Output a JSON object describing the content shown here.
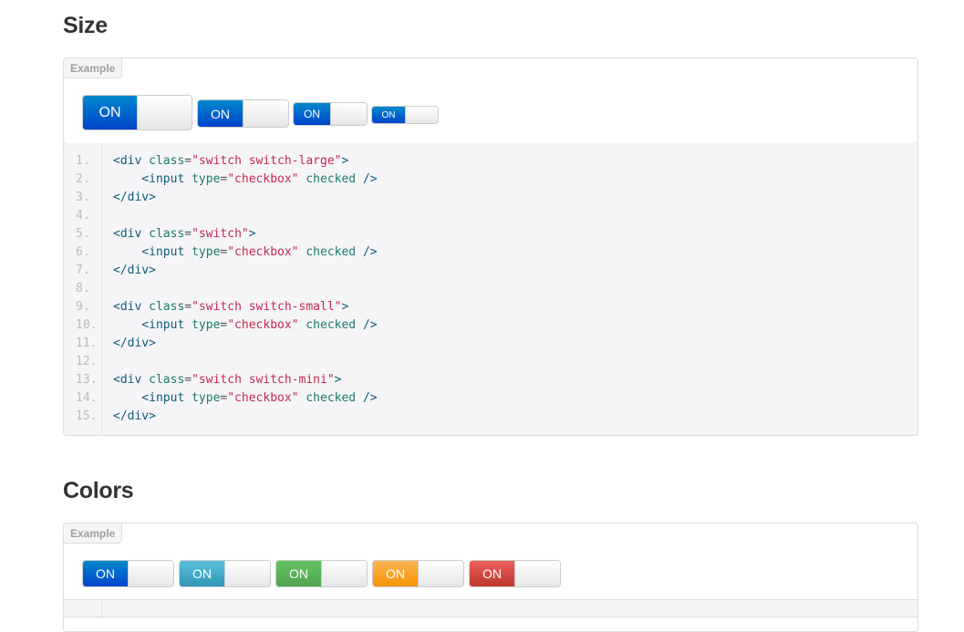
{
  "size_section": {
    "title": "Size",
    "example_label": "Example",
    "switch_label": "ON",
    "code_lines": [
      {
        "num": "1.",
        "parts": [
          [
            "tag",
            "<div "
          ],
          [
            "attr",
            "class"
          ],
          [
            "pun",
            "="
          ],
          [
            "str",
            "\"switch switch-large\""
          ],
          [
            "tag",
            ">"
          ]
        ]
      },
      {
        "num": "2.",
        "parts": [
          [
            "tag",
            "    <input "
          ],
          [
            "attr",
            "type"
          ],
          [
            "pun",
            "="
          ],
          [
            "str",
            "\"checkbox\""
          ],
          [
            "attr",
            " checked"
          ],
          [
            "tag",
            " />"
          ]
        ]
      },
      {
        "num": "3.",
        "parts": [
          [
            "tag",
            "</div>"
          ]
        ]
      },
      {
        "num": "4.",
        "parts": []
      },
      {
        "num": "5.",
        "parts": [
          [
            "tag",
            "<div "
          ],
          [
            "attr",
            "class"
          ],
          [
            "pun",
            "="
          ],
          [
            "str",
            "\"switch\""
          ],
          [
            "tag",
            ">"
          ]
        ]
      },
      {
        "num": "6.",
        "parts": [
          [
            "tag",
            "    <input "
          ],
          [
            "attr",
            "type"
          ],
          [
            "pun",
            "="
          ],
          [
            "str",
            "\"checkbox\""
          ],
          [
            "attr",
            " checked"
          ],
          [
            "tag",
            " />"
          ]
        ]
      },
      {
        "num": "7.",
        "parts": [
          [
            "tag",
            "</div>"
          ]
        ]
      },
      {
        "num": "8.",
        "parts": []
      },
      {
        "num": "9.",
        "parts": [
          [
            "tag",
            "<div "
          ],
          [
            "attr",
            "class"
          ],
          [
            "pun",
            "="
          ],
          [
            "str",
            "\"switch switch-small\""
          ],
          [
            "tag",
            ">"
          ]
        ]
      },
      {
        "num": "10.",
        "parts": [
          [
            "tag",
            "    <input "
          ],
          [
            "attr",
            "type"
          ],
          [
            "pun",
            "="
          ],
          [
            "str",
            "\"checkbox\""
          ],
          [
            "attr",
            " checked"
          ],
          [
            "tag",
            " />"
          ]
        ]
      },
      {
        "num": "11.",
        "parts": [
          [
            "tag",
            "</div>"
          ]
        ]
      },
      {
        "num": "12.",
        "parts": []
      },
      {
        "num": "13.",
        "parts": [
          [
            "tag",
            "<div "
          ],
          [
            "attr",
            "class"
          ],
          [
            "pun",
            "="
          ],
          [
            "str",
            "\"switch switch-mini\""
          ],
          [
            "tag",
            ">"
          ]
        ]
      },
      {
        "num": "14.",
        "parts": [
          [
            "tag",
            "    <input "
          ],
          [
            "attr",
            "type"
          ],
          [
            "pun",
            "="
          ],
          [
            "str",
            "\"checkbox\""
          ],
          [
            "attr",
            " checked"
          ],
          [
            "tag",
            " />"
          ]
        ]
      },
      {
        "num": "15.",
        "parts": [
          [
            "tag",
            "</div>"
          ]
        ]
      }
    ]
  },
  "colors_section": {
    "title": "Colors",
    "example_label": "Example",
    "switch_label": "ON",
    "switch_colors": [
      "primary",
      "info",
      "success",
      "warning",
      "danger"
    ]
  },
  "colors": {
    "primary": "#0055cc",
    "info": "#3fa9c9",
    "success": "#5cb85c",
    "warning": "#f89406",
    "danger": "#d9403a"
  }
}
